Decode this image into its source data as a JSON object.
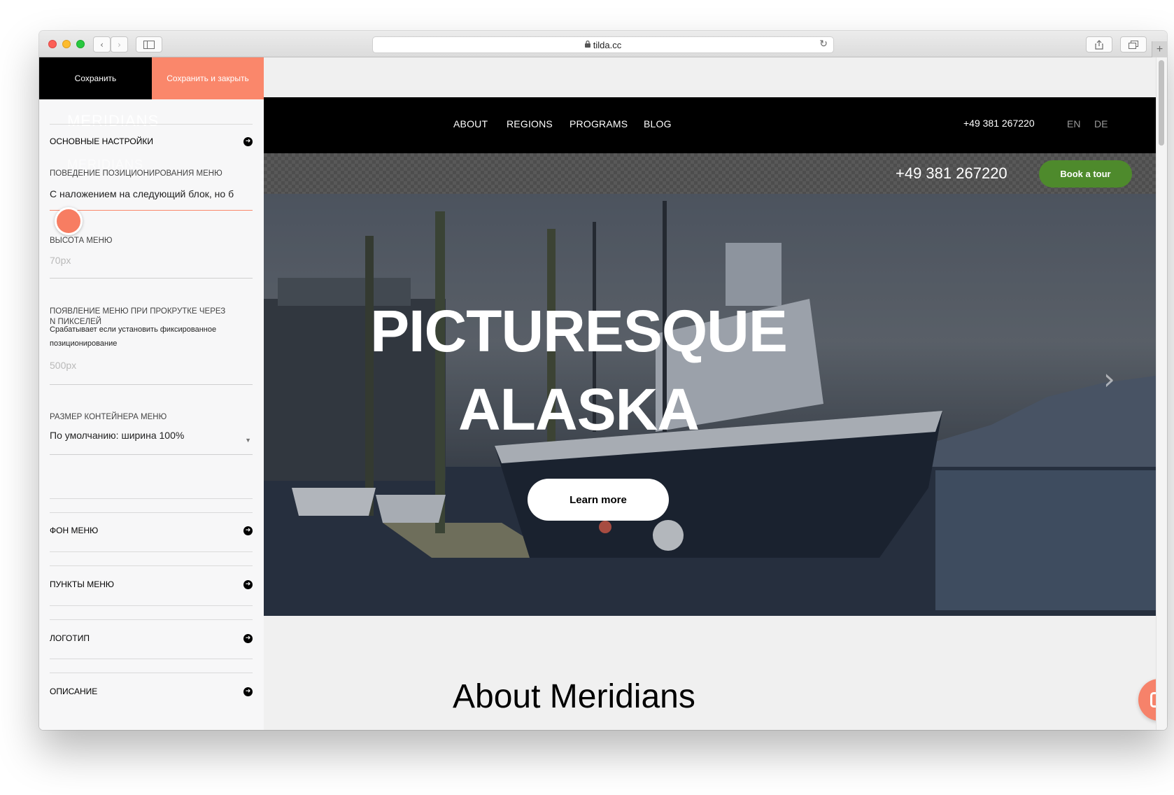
{
  "browser": {
    "url": "tilda.cc",
    "back_icon": "‹",
    "forward_icon": "›",
    "plus_icon": "+"
  },
  "panel": {
    "save_label": "Сохранить",
    "save_close_label": "Сохранить и закрыть",
    "ghost_text": "MERIDIANS",
    "sections": {
      "main_settings": "ОСНОВНЫЕ НАСТРОЙКИ",
      "menu_bg": "ФОН МЕНЮ",
      "menu_items": "ПУНКТЫ МЕНЮ",
      "logo": "ЛОГОТИП",
      "description": "ОПИСАНИЕ"
    },
    "fields": {
      "positioning_label": "ПОВЕДЕНИЕ ПОЗИЦИОНИРОВАНИЯ МЕНЮ",
      "positioning_value": "С наложением на следующий блок, но б",
      "height_label": "ВЫСОТА МЕНЮ",
      "height_placeholder": "70px",
      "scroll_label": "ПОЯВЛЕНИЕ МЕНЮ ПРИ ПРОКРУТКЕ ЧЕРЕЗ N ПИКСЕЛЕЙ",
      "scroll_hint": "Срабатывает если установить фиксированное позиционирование",
      "scroll_placeholder": "500px",
      "container_label": "РАЗМЕР КОНТЕЙНЕРА МЕНЮ",
      "container_value": "По умолчанию: ширина 100%"
    }
  },
  "site": {
    "nav": [
      "ABOUT",
      "REGIONS",
      "PROGRAMS",
      "BLOG"
    ],
    "phone": "+49 381 267220",
    "lang": [
      "EN",
      "DE"
    ],
    "sub_phone": "+49 381 267220",
    "book_label": "Book a tour",
    "hero_title_1": "PICTURESQUE",
    "hero_title_2": "ALASKA",
    "learn_label": "Learn more",
    "slide_arrow": "›",
    "about_title": "About Meridians"
  },
  "colors": {
    "accent": "#fa876b",
    "book_green": "#4e8a2c",
    "nav_black": "#000000"
  }
}
